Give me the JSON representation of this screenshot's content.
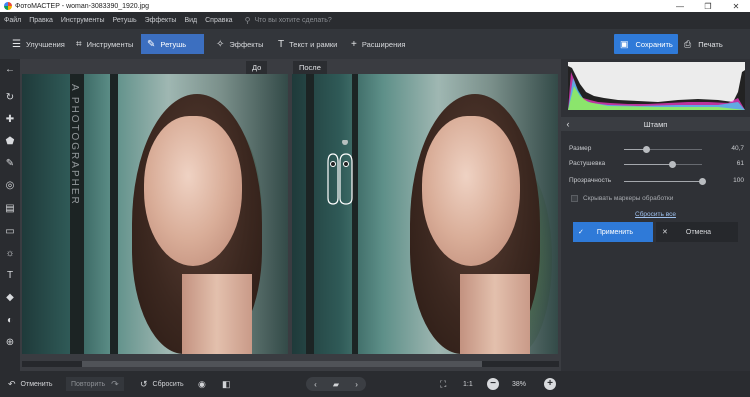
{
  "window": {
    "title": "ФотоМАСТЕР - woman-3083390_1920.jpg",
    "minimize": "—",
    "maximize": "❐",
    "close": "✕"
  },
  "menu": {
    "items": [
      "Файл",
      "Правка",
      "Инструменты",
      "Ретушь",
      "Эффекты",
      "Вид",
      "Справка"
    ],
    "search_placeholder": "Что вы хотите сделать?"
  },
  "toolbar": {
    "tabs": [
      {
        "label": "Улучшения",
        "icon": "sliders-icon",
        "glyph": "☰"
      },
      {
        "label": "Инструменты",
        "icon": "crop-icon",
        "glyph": "⌗"
      },
      {
        "label": "Ретушь",
        "icon": "brush-icon",
        "glyph": "✎",
        "active": true
      },
      {
        "label": "Эффекты",
        "icon": "effects-icon",
        "glyph": "✧"
      },
      {
        "label": "Текст и рамки",
        "icon": "text-icon",
        "glyph": "T"
      },
      {
        "label": "Расширения",
        "icon": "plus-icon",
        "glyph": "+"
      }
    ],
    "save_label": "Сохранить",
    "print_label": "Печать"
  },
  "left_tools": [
    {
      "name": "back-arrow-icon",
      "glyph": "←"
    },
    {
      "name": "rotate-icon",
      "glyph": "↻"
    },
    {
      "name": "healing-icon",
      "glyph": "✚"
    },
    {
      "name": "stamp-icon",
      "glyph": "⬟"
    },
    {
      "name": "brush-tool-icon",
      "glyph": "✎"
    },
    {
      "name": "radial-icon",
      "glyph": "◎"
    },
    {
      "name": "gradient-icon",
      "glyph": "▤"
    },
    {
      "name": "vignette-icon",
      "glyph": "▭"
    },
    {
      "name": "light-icon",
      "glyph": "☼"
    },
    {
      "name": "text-tool-icon",
      "glyph": "T"
    },
    {
      "name": "fill-icon",
      "glyph": "◆"
    },
    {
      "name": "eraser-icon",
      "glyph": "◐"
    },
    {
      "name": "target-icon",
      "glyph": "⊕"
    }
  ],
  "canvas": {
    "before_label": "До",
    "after_label": "После",
    "watermark": "A PHOTOGRAPHER"
  },
  "panel": {
    "title": "Штамп",
    "sliders": [
      {
        "label": "Размер",
        "value": "40,7",
        "level": 0.28
      },
      {
        "label": "Растушевка",
        "value": "61",
        "level": 0.61
      },
      {
        "label": "Прозрачность",
        "value": "100",
        "level": 1.0
      }
    ],
    "checkbox_label": "Скрывать маркеры обработки",
    "reset_label": "Сбросить все",
    "apply_label": "Применить",
    "cancel_label": "Отмена"
  },
  "bottom": {
    "undo_label": "Отменить",
    "redo_label": "Повторить",
    "reset_label": "Сбросить",
    "ratio_label": "1:1",
    "zoom_label": "38%"
  },
  "colors": {
    "accent": "#2f7ad8",
    "active_tab": "#3c6fc0",
    "panel_bg": "#2f3136",
    "app_bg": "#2b2d31"
  }
}
